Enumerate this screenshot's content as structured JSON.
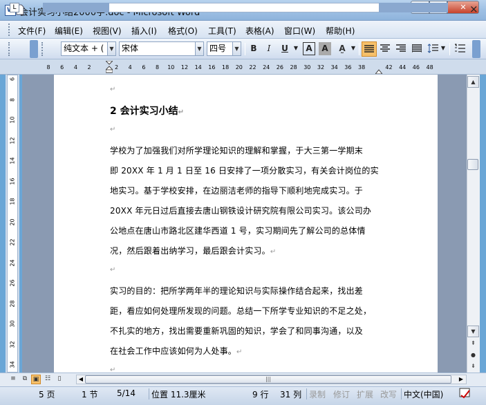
{
  "window": {
    "title": "会计实习小结2000字.doc - Microsoft Word",
    "icon": "word-doc-icon",
    "buttons": {
      "minimize": "─",
      "maximize": "□",
      "close": "✕"
    }
  },
  "menubar": {
    "items": [
      "文件(F)",
      "编辑(E)",
      "视图(V)",
      "插入(I)",
      "格式(O)",
      "工具(T)",
      "表格(A)",
      "窗口(W)",
      "帮助(H)"
    ],
    "close_doc": "×"
  },
  "toolbar": {
    "style_value": "纯文本 + (",
    "font_value": "宋体",
    "size_value": "四号",
    "bold": "B",
    "italic": "I",
    "underline": "U",
    "char_border": "A",
    "char_shading": "A",
    "bullets": "☰"
  },
  "ruler": {
    "numbers": [
      "8",
      "6",
      "4",
      "2",
      "",
      "2",
      "4",
      "6",
      "8",
      "10",
      "12",
      "14",
      "16",
      "18",
      "20",
      "22",
      "24",
      "26",
      "28",
      "30",
      "32",
      "34",
      "36",
      "38",
      "",
      "42",
      "44",
      "46",
      "48"
    ],
    "vertical_numbers": [
      "6",
      "8",
      "10",
      "12",
      "14",
      "16",
      "18",
      "20",
      "22",
      "24",
      "26",
      "28",
      "30",
      "32",
      "34"
    ]
  },
  "document": {
    "para_mark": "↵",
    "heading": "2 会计实习小结",
    "paragraph1": [
      "学校为了加强我们对所学理论知识的理解和掌握，于大三第一学期末",
      "即 20XX 年 1 月 1 日至 16 日安排了一项分散实习，有关会计岗位的实",
      "地实习。基于学校安排，在边丽洁老师的指导下顺利地完成实习。于",
      "20XX 年元日过后直接去唐山钢铁设计研究院有限公司实习。该公司办",
      "公地点在唐山市路北区建华西道 1 号，实习期间先了解公司的总体情",
      "况，然后跟着出纳学习，最后跟会计实习。"
    ],
    "paragraph2": [
      "实习的目的：把所学两年半的理论知识与实际操作结合起来，找出差",
      "距，看应如何处理所发现的问题。总结一下所学专业知识的不足之处，",
      "不扎实的地方，找出需要重新巩固的知识，学会了和同事沟通，以及",
      "在社会工作中应该如何为人处事。"
    ]
  },
  "statusbar": {
    "page": "5 页",
    "section": "1 节",
    "page_of": "5/14",
    "position": "位置 11.3厘米",
    "line": "9 行",
    "column": "31 列",
    "rec": "录制",
    "trk": "修订",
    "ext": "扩展",
    "ovr": "改写",
    "language": "中文(中国)"
  }
}
